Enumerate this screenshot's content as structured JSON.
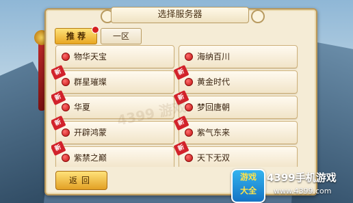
{
  "dialog": {
    "title": "选择服务器",
    "tabs": [
      {
        "label": "推  荐",
        "active": true
      },
      {
        "label": "一区",
        "active": false
      }
    ],
    "back_label": "返回"
  },
  "servers": [
    {
      "name": "物华天宝",
      "new": false
    },
    {
      "name": "海纳百川",
      "new": false
    },
    {
      "name": "群星璀璨",
      "new": true
    },
    {
      "name": "黄金时代",
      "new": true
    },
    {
      "name": "华夏",
      "new": true
    },
    {
      "name": "梦回唐朝",
      "new": true
    },
    {
      "name": "开辟鸿蒙",
      "new": true
    },
    {
      "name": "紫气东来",
      "new": true
    },
    {
      "name": "紫禁之巅",
      "new": true
    },
    {
      "name": "天下无双",
      "new": true
    }
  ],
  "new_badge_label": "新",
  "watermark": "4399 游戏",
  "branding": {
    "logo_line1": "游戏",
    "logo_line2": "大全",
    "title": "4399手机游戏",
    "url": "www.4399.com"
  },
  "colors": {
    "accent": "#e8a622",
    "status_dot": "#c01010",
    "panel_bg": "#f5ecd6"
  }
}
